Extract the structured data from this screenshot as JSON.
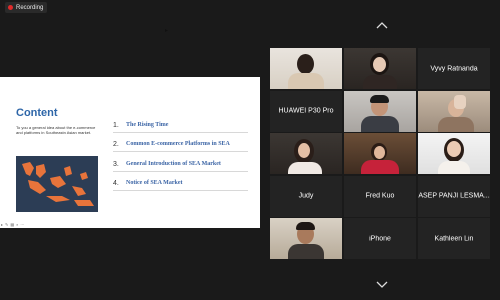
{
  "recording": {
    "label": "Recording",
    "color": "#e02b2b"
  },
  "shared_screen": {
    "slide_title": "Content",
    "slide_subtitle": "To you a general idea about the e-commerce and platforms in Southeastn Asian market.",
    "toc": [
      {
        "num": "1.",
        "label": "The Rising Time"
      },
      {
        "num": "2.",
        "label": "Common E-commerce Platforms in SEA"
      },
      {
        "num": "3.",
        "label": "General Introduction of SEA Market"
      },
      {
        "num": "4.",
        "label": "Notice of SEA Market"
      }
    ],
    "accent_color": "#2e66a8"
  },
  "gallery": {
    "scroll_up_icon": "chevron-up-icon",
    "scroll_down_icon": "chevron-down-icon",
    "participants": [
      {
        "kind": "video",
        "tone": "cream"
      },
      {
        "kind": "video",
        "tone": "dark"
      },
      {
        "kind": "name",
        "name": "Vyvy Ratnanda"
      },
      {
        "kind": "name",
        "name": "HUAWEI P30 Pro"
      },
      {
        "kind": "video",
        "tone": "gray",
        "active_speaker": true
      },
      {
        "kind": "video",
        "tone": "warm"
      },
      {
        "kind": "video",
        "tone": "dark"
      },
      {
        "kind": "video",
        "tone": "shelf"
      },
      {
        "kind": "video",
        "tone": "white"
      },
      {
        "kind": "name",
        "name": "Judy"
      },
      {
        "kind": "name",
        "name": "Fred Kuo"
      },
      {
        "kind": "name",
        "name": "ASEP PANJI LESMA..."
      },
      {
        "kind": "video",
        "tone": "wall"
      },
      {
        "kind": "name",
        "name": "iPhone"
      },
      {
        "kind": "name",
        "name": "Kathleen Lin"
      }
    ]
  }
}
